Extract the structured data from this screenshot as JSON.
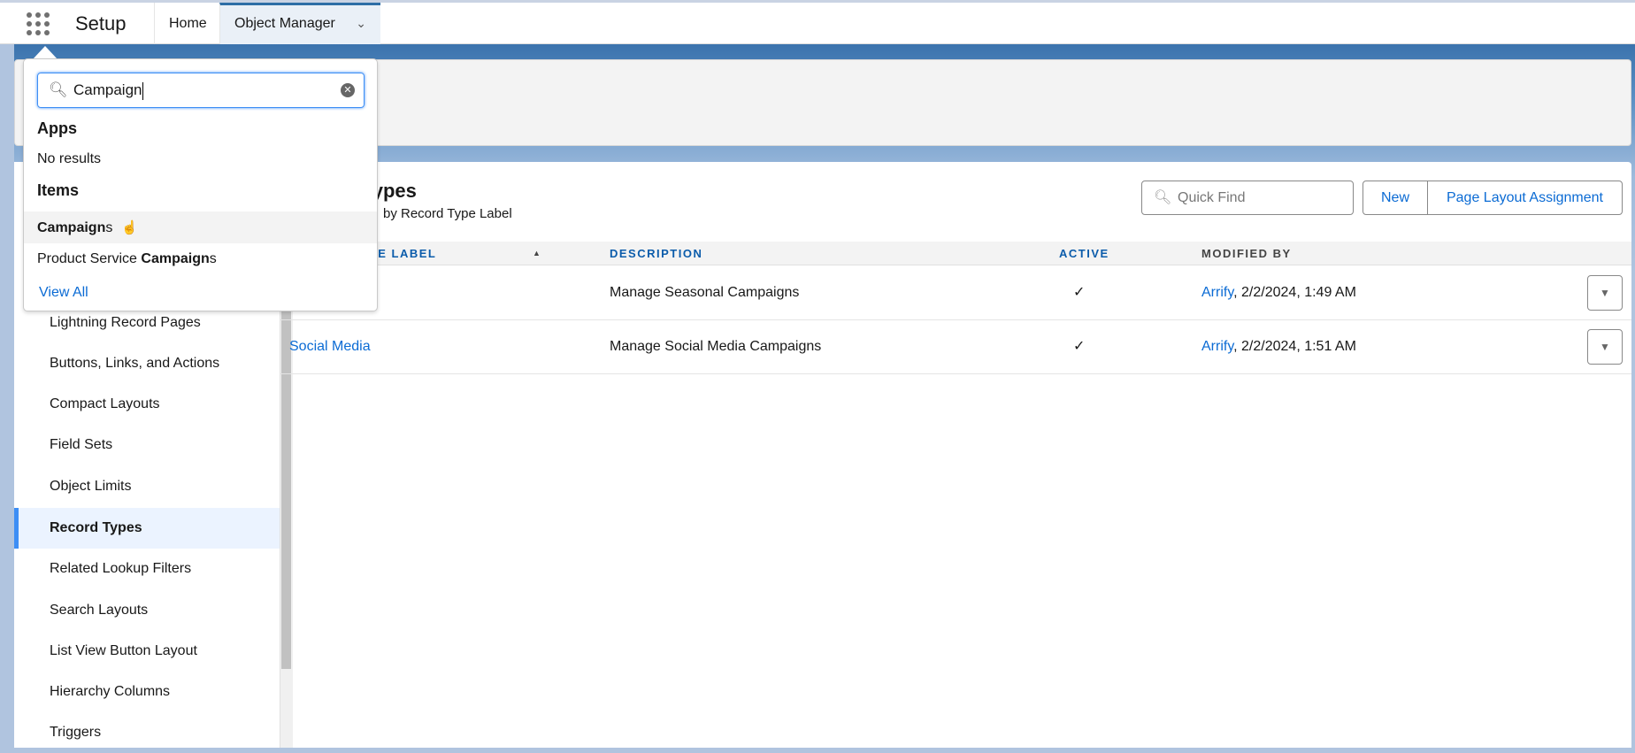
{
  "nav": {
    "app_name": "Setup",
    "tabs": [
      {
        "label": "Home"
      },
      {
        "label": "Object Manager"
      }
    ]
  },
  "sidebar": {
    "items": [
      {
        "label": "Lightning Record Pages"
      },
      {
        "label": "Buttons, Links, and Actions"
      },
      {
        "label": "Compact Layouts"
      },
      {
        "label": "Field Sets"
      },
      {
        "label": "Object Limits"
      },
      {
        "label": "Record Types",
        "active": true
      },
      {
        "label": "Related Lookup Filters"
      },
      {
        "label": "Search Layouts"
      },
      {
        "label": "List View Button Layout"
      },
      {
        "label": "Hierarchy Columns"
      },
      {
        "label": "Triggers"
      }
    ]
  },
  "content": {
    "title": "Record Types",
    "subtitle": "by Record Type Label",
    "quick_find_placeholder": "Quick Find",
    "new_label": "New",
    "page_layout_label": "Page Layout Assignment",
    "columns": {
      "label": "RECORD TYPE LABEL",
      "description": "DESCRIPTION",
      "active": "ACTIVE",
      "modified_by": "MODIFIED BY"
    },
    "rows": [
      {
        "label": "",
        "description": "Manage Seasonal Campaigns",
        "active": "✓",
        "user": "Arrify",
        "date": ", 2/2/2024, 1:49 AM"
      },
      {
        "label": "Social Media",
        "description": "Manage Social Media Campaigns",
        "active": "✓",
        "user": "Arrify",
        "date": ", 2/2/2024, 1:51 AM"
      }
    ]
  },
  "dropdown": {
    "search_value": "Campaign",
    "apps_heading": "Apps",
    "apps_empty": "No results",
    "items_heading": "Items",
    "items": [
      {
        "match": "Campaign",
        "rest": "s",
        "prefix": ""
      },
      {
        "prefix": "Product Service ",
        "match": "Campaign",
        "rest": "s"
      }
    ],
    "view_all": "View All"
  },
  "colors": {
    "brand_blue": "#0b6bd4",
    "active_indicator": "#3d8ef5",
    "nav_accent": "#2e6ea6"
  }
}
